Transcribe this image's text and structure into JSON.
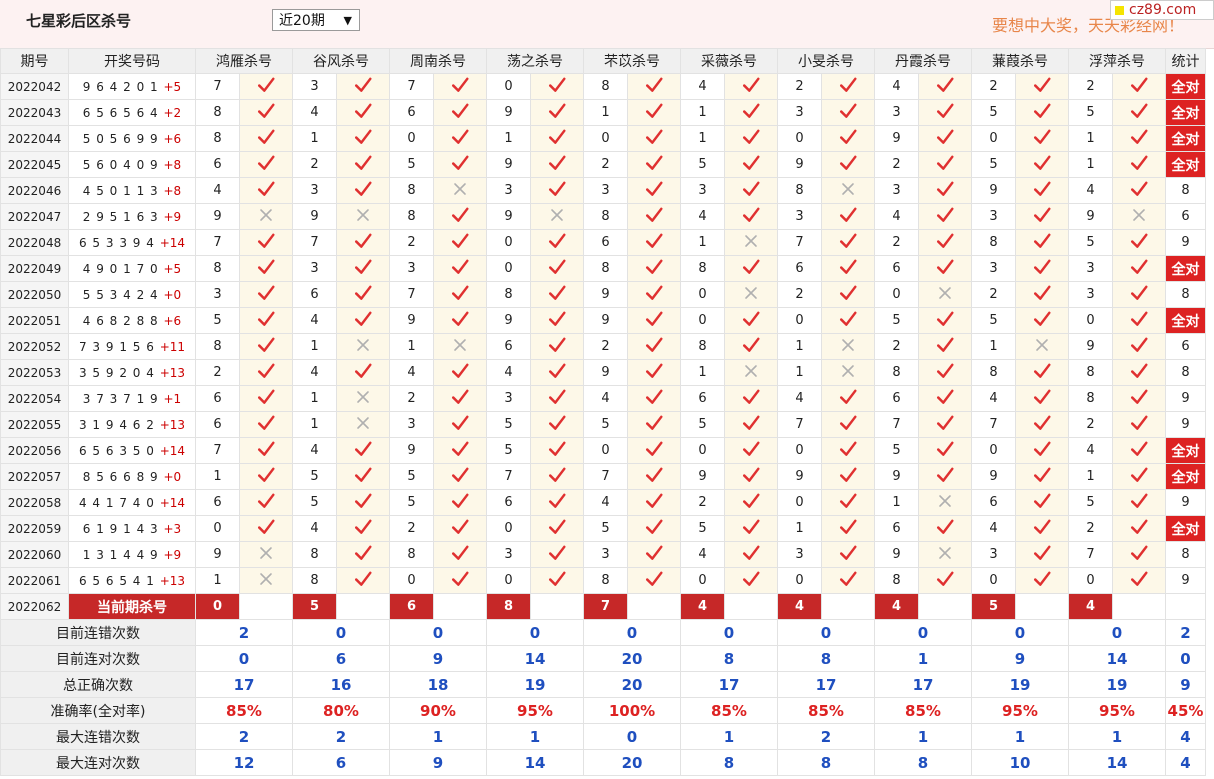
{
  "header": {
    "title": "七星彩后区杀号",
    "period_select": "近20期",
    "slogan": "要想中大奖，天天彩经网！",
    "logo": "cz89.com"
  },
  "columns": {
    "issue": "期号",
    "draw": "开奖号码",
    "experts": [
      "鸿雁杀号",
      "谷风杀号",
      "周南杀号",
      "荡之杀号",
      "芣苡杀号",
      "采薇杀号",
      "小旻杀号",
      "丹霞杀号",
      "蒹葭杀号",
      "浮萍杀号"
    ],
    "stat": "统计"
  },
  "all_correct_label": "全对",
  "rows": [
    {
      "issue": "2022042",
      "nums": "9 6 4 2 0 1",
      "extra": "+5",
      "kills": [
        "7",
        "3",
        "7",
        "0",
        "8",
        "4",
        "2",
        "4",
        "2",
        "2"
      ],
      "res": [
        1,
        1,
        1,
        1,
        1,
        1,
        1,
        1,
        1,
        1
      ],
      "stat": "全对"
    },
    {
      "issue": "2022043",
      "nums": "6 5 6 5 6 4",
      "extra": "+2",
      "kills": [
        "8",
        "4",
        "6",
        "9",
        "1",
        "1",
        "3",
        "3",
        "5",
        "5"
      ],
      "res": [
        1,
        1,
        1,
        1,
        1,
        1,
        1,
        1,
        1,
        1
      ],
      "stat": "全对"
    },
    {
      "issue": "2022044",
      "nums": "5 0 5 6 9 9",
      "extra": "+6",
      "kills": [
        "8",
        "1",
        "0",
        "1",
        "0",
        "1",
        "0",
        "9",
        "0",
        "1"
      ],
      "res": [
        1,
        1,
        1,
        1,
        1,
        1,
        1,
        1,
        1,
        1
      ],
      "stat": "全对"
    },
    {
      "issue": "2022045",
      "nums": "5 6 0 4 0 9",
      "extra": "+8",
      "kills": [
        "6",
        "2",
        "5",
        "9",
        "2",
        "5",
        "9",
        "2",
        "5",
        "1"
      ],
      "res": [
        1,
        1,
        1,
        1,
        1,
        1,
        1,
        1,
        1,
        1
      ],
      "stat": "全对"
    },
    {
      "issue": "2022046",
      "nums": "4 5 0 1 1 3",
      "extra": "+8",
      "kills": [
        "4",
        "3",
        "8",
        "3",
        "3",
        "3",
        "8",
        "3",
        "9",
        "4"
      ],
      "res": [
        1,
        1,
        0,
        1,
        1,
        1,
        0,
        1,
        1,
        1
      ],
      "stat": "8"
    },
    {
      "issue": "2022047",
      "nums": "2 9 5 1 6 3",
      "extra": "+9",
      "kills": [
        "9",
        "9",
        "8",
        "9",
        "8",
        "4",
        "3",
        "4",
        "3",
        "9"
      ],
      "res": [
        0,
        0,
        1,
        0,
        1,
        1,
        1,
        1,
        1,
        0
      ],
      "stat": "6"
    },
    {
      "issue": "2022048",
      "nums": "6 5 3 3 9 4",
      "extra": "+14",
      "kills": [
        "7",
        "7",
        "2",
        "0",
        "6",
        "1",
        "7",
        "2",
        "8",
        "5"
      ],
      "res": [
        1,
        1,
        1,
        1,
        1,
        0,
        1,
        1,
        1,
        1
      ],
      "stat": "9"
    },
    {
      "issue": "2022049",
      "nums": "4 9 0 1 7 0",
      "extra": "+5",
      "kills": [
        "8",
        "3",
        "3",
        "0",
        "8",
        "8",
        "6",
        "6",
        "3",
        "3"
      ],
      "res": [
        1,
        1,
        1,
        1,
        1,
        1,
        1,
        1,
        1,
        1
      ],
      "stat": "全对"
    },
    {
      "issue": "2022050",
      "nums": "5 5 3 4 2 4",
      "extra": "+0",
      "kills": [
        "3",
        "6",
        "7",
        "8",
        "9",
        "0",
        "2",
        "0",
        "2",
        "3"
      ],
      "res": [
        1,
        1,
        1,
        1,
        1,
        0,
        1,
        0,
        1,
        1
      ],
      "stat": "8"
    },
    {
      "issue": "2022051",
      "nums": "4 6 8 2 8 8",
      "extra": "+6",
      "kills": [
        "5",
        "4",
        "9",
        "9",
        "9",
        "0",
        "0",
        "5",
        "5",
        "0"
      ],
      "res": [
        1,
        1,
        1,
        1,
        1,
        1,
        1,
        1,
        1,
        1
      ],
      "stat": "全对"
    },
    {
      "issue": "2022052",
      "nums": "7 3 9 1 5 6",
      "extra": "+11",
      "kills": [
        "8",
        "1",
        "1",
        "6",
        "2",
        "8",
        "1",
        "2",
        "1",
        "9"
      ],
      "res": [
        1,
        0,
        0,
        1,
        1,
        1,
        0,
        1,
        0,
        1
      ],
      "stat": "6"
    },
    {
      "issue": "2022053",
      "nums": "3 5 9 2 0 4",
      "extra": "+13",
      "kills": [
        "2",
        "4",
        "4",
        "4",
        "9",
        "1",
        "1",
        "8",
        "8",
        "8"
      ],
      "res": [
        1,
        1,
        1,
        1,
        1,
        0,
        0,
        1,
        1,
        1
      ],
      "stat": "8"
    },
    {
      "issue": "2022054",
      "nums": "3 7 3 7 1 9",
      "extra": "+1",
      "kills": [
        "6",
        "1",
        "2",
        "3",
        "4",
        "6",
        "4",
        "6",
        "4",
        "8"
      ],
      "res": [
        1,
        0,
        1,
        1,
        1,
        1,
        1,
        1,
        1,
        1
      ],
      "stat": "9"
    },
    {
      "issue": "2022055",
      "nums": "3 1 9 4 6 2",
      "extra": "+13",
      "kills": [
        "6",
        "1",
        "3",
        "5",
        "5",
        "5",
        "7",
        "7",
        "7",
        "2"
      ],
      "res": [
        1,
        0,
        1,
        1,
        1,
        1,
        1,
        1,
        1,
        1
      ],
      "stat": "9"
    },
    {
      "issue": "2022056",
      "nums": "6 5 6 3 5 0",
      "extra": "+14",
      "kills": [
        "7",
        "4",
        "9",
        "5",
        "0",
        "0",
        "0",
        "5",
        "0",
        "4"
      ],
      "res": [
        1,
        1,
        1,
        1,
        1,
        1,
        1,
        1,
        1,
        1
      ],
      "stat": "全对"
    },
    {
      "issue": "2022057",
      "nums": "8 5 6 6 8 9",
      "extra": "+0",
      "kills": [
        "1",
        "5",
        "5",
        "7",
        "7",
        "9",
        "9",
        "9",
        "9",
        "1"
      ],
      "res": [
        1,
        1,
        1,
        1,
        1,
        1,
        1,
        1,
        1,
        1
      ],
      "stat": "全对"
    },
    {
      "issue": "2022058",
      "nums": "4 4 1 7 4 0",
      "extra": "+14",
      "kills": [
        "6",
        "5",
        "5",
        "6",
        "4",
        "2",
        "0",
        "1",
        "6",
        "5"
      ],
      "res": [
        1,
        1,
        1,
        1,
        1,
        1,
        1,
        0,
        1,
        1
      ],
      "stat": "9"
    },
    {
      "issue": "2022059",
      "nums": "6 1 9 1 4 3",
      "extra": "+3",
      "kills": [
        "0",
        "4",
        "2",
        "0",
        "5",
        "5",
        "1",
        "6",
        "4",
        "2"
      ],
      "res": [
        1,
        1,
        1,
        1,
        1,
        1,
        1,
        1,
        1,
        1
      ],
      "stat": "全对"
    },
    {
      "issue": "2022060",
      "nums": "1 3 1 4 4 9",
      "extra": "+9",
      "kills": [
        "9",
        "8",
        "8",
        "3",
        "3",
        "4",
        "3",
        "9",
        "3",
        "7"
      ],
      "res": [
        0,
        1,
        1,
        1,
        1,
        1,
        1,
        0,
        1,
        1
      ],
      "stat": "8"
    },
    {
      "issue": "2022061",
      "nums": "6 5 6 5 4 1",
      "extra": "+13",
      "kills": [
        "1",
        "8",
        "0",
        "0",
        "8",
        "0",
        "0",
        "8",
        "0",
        "0"
      ],
      "res": [
        0,
        1,
        1,
        1,
        1,
        1,
        1,
        1,
        1,
        1
      ],
      "stat": "9"
    }
  ],
  "current": {
    "issue": "2022062",
    "label": "当前期杀号",
    "kills": [
      "0",
      "5",
      "6",
      "8",
      "7",
      "4",
      "4",
      "4",
      "5",
      "4"
    ]
  },
  "summary": [
    {
      "label": "目前连错次数",
      "values": [
        "2",
        "0",
        "0",
        "0",
        "0",
        "0",
        "0",
        "0",
        "0",
        "0"
      ],
      "stat": "2",
      "red": false
    },
    {
      "label": "目前连对次数",
      "values": [
        "0",
        "6",
        "9",
        "14",
        "20",
        "8",
        "8",
        "1",
        "9",
        "14"
      ],
      "stat": "0",
      "red": false
    },
    {
      "label": "总正确次数",
      "values": [
        "17",
        "16",
        "18",
        "19",
        "20",
        "17",
        "17",
        "17",
        "19",
        "19"
      ],
      "stat": "9",
      "red": false
    },
    {
      "label": "准确率(全对率)",
      "values": [
        "85%",
        "80%",
        "90%",
        "95%",
        "100%",
        "85%",
        "85%",
        "85%",
        "95%",
        "95%"
      ],
      "stat": "45%",
      "red": true
    },
    {
      "label": "最大连错次数",
      "values": [
        "2",
        "2",
        "1",
        "1",
        "0",
        "1",
        "2",
        "1",
        "1",
        "1"
      ],
      "stat": "4",
      "red": false
    },
    {
      "label": "最大连对次数",
      "values": [
        "12",
        "6",
        "9",
        "14",
        "20",
        "8",
        "8",
        "8",
        "10",
        "14"
      ],
      "stat": "4",
      "red": false
    }
  ],
  "colors": {
    "check": "#e03030",
    "cross": "#b0b0b0",
    "accent": "#c62828",
    "blue": "#1f4fbf"
  }
}
